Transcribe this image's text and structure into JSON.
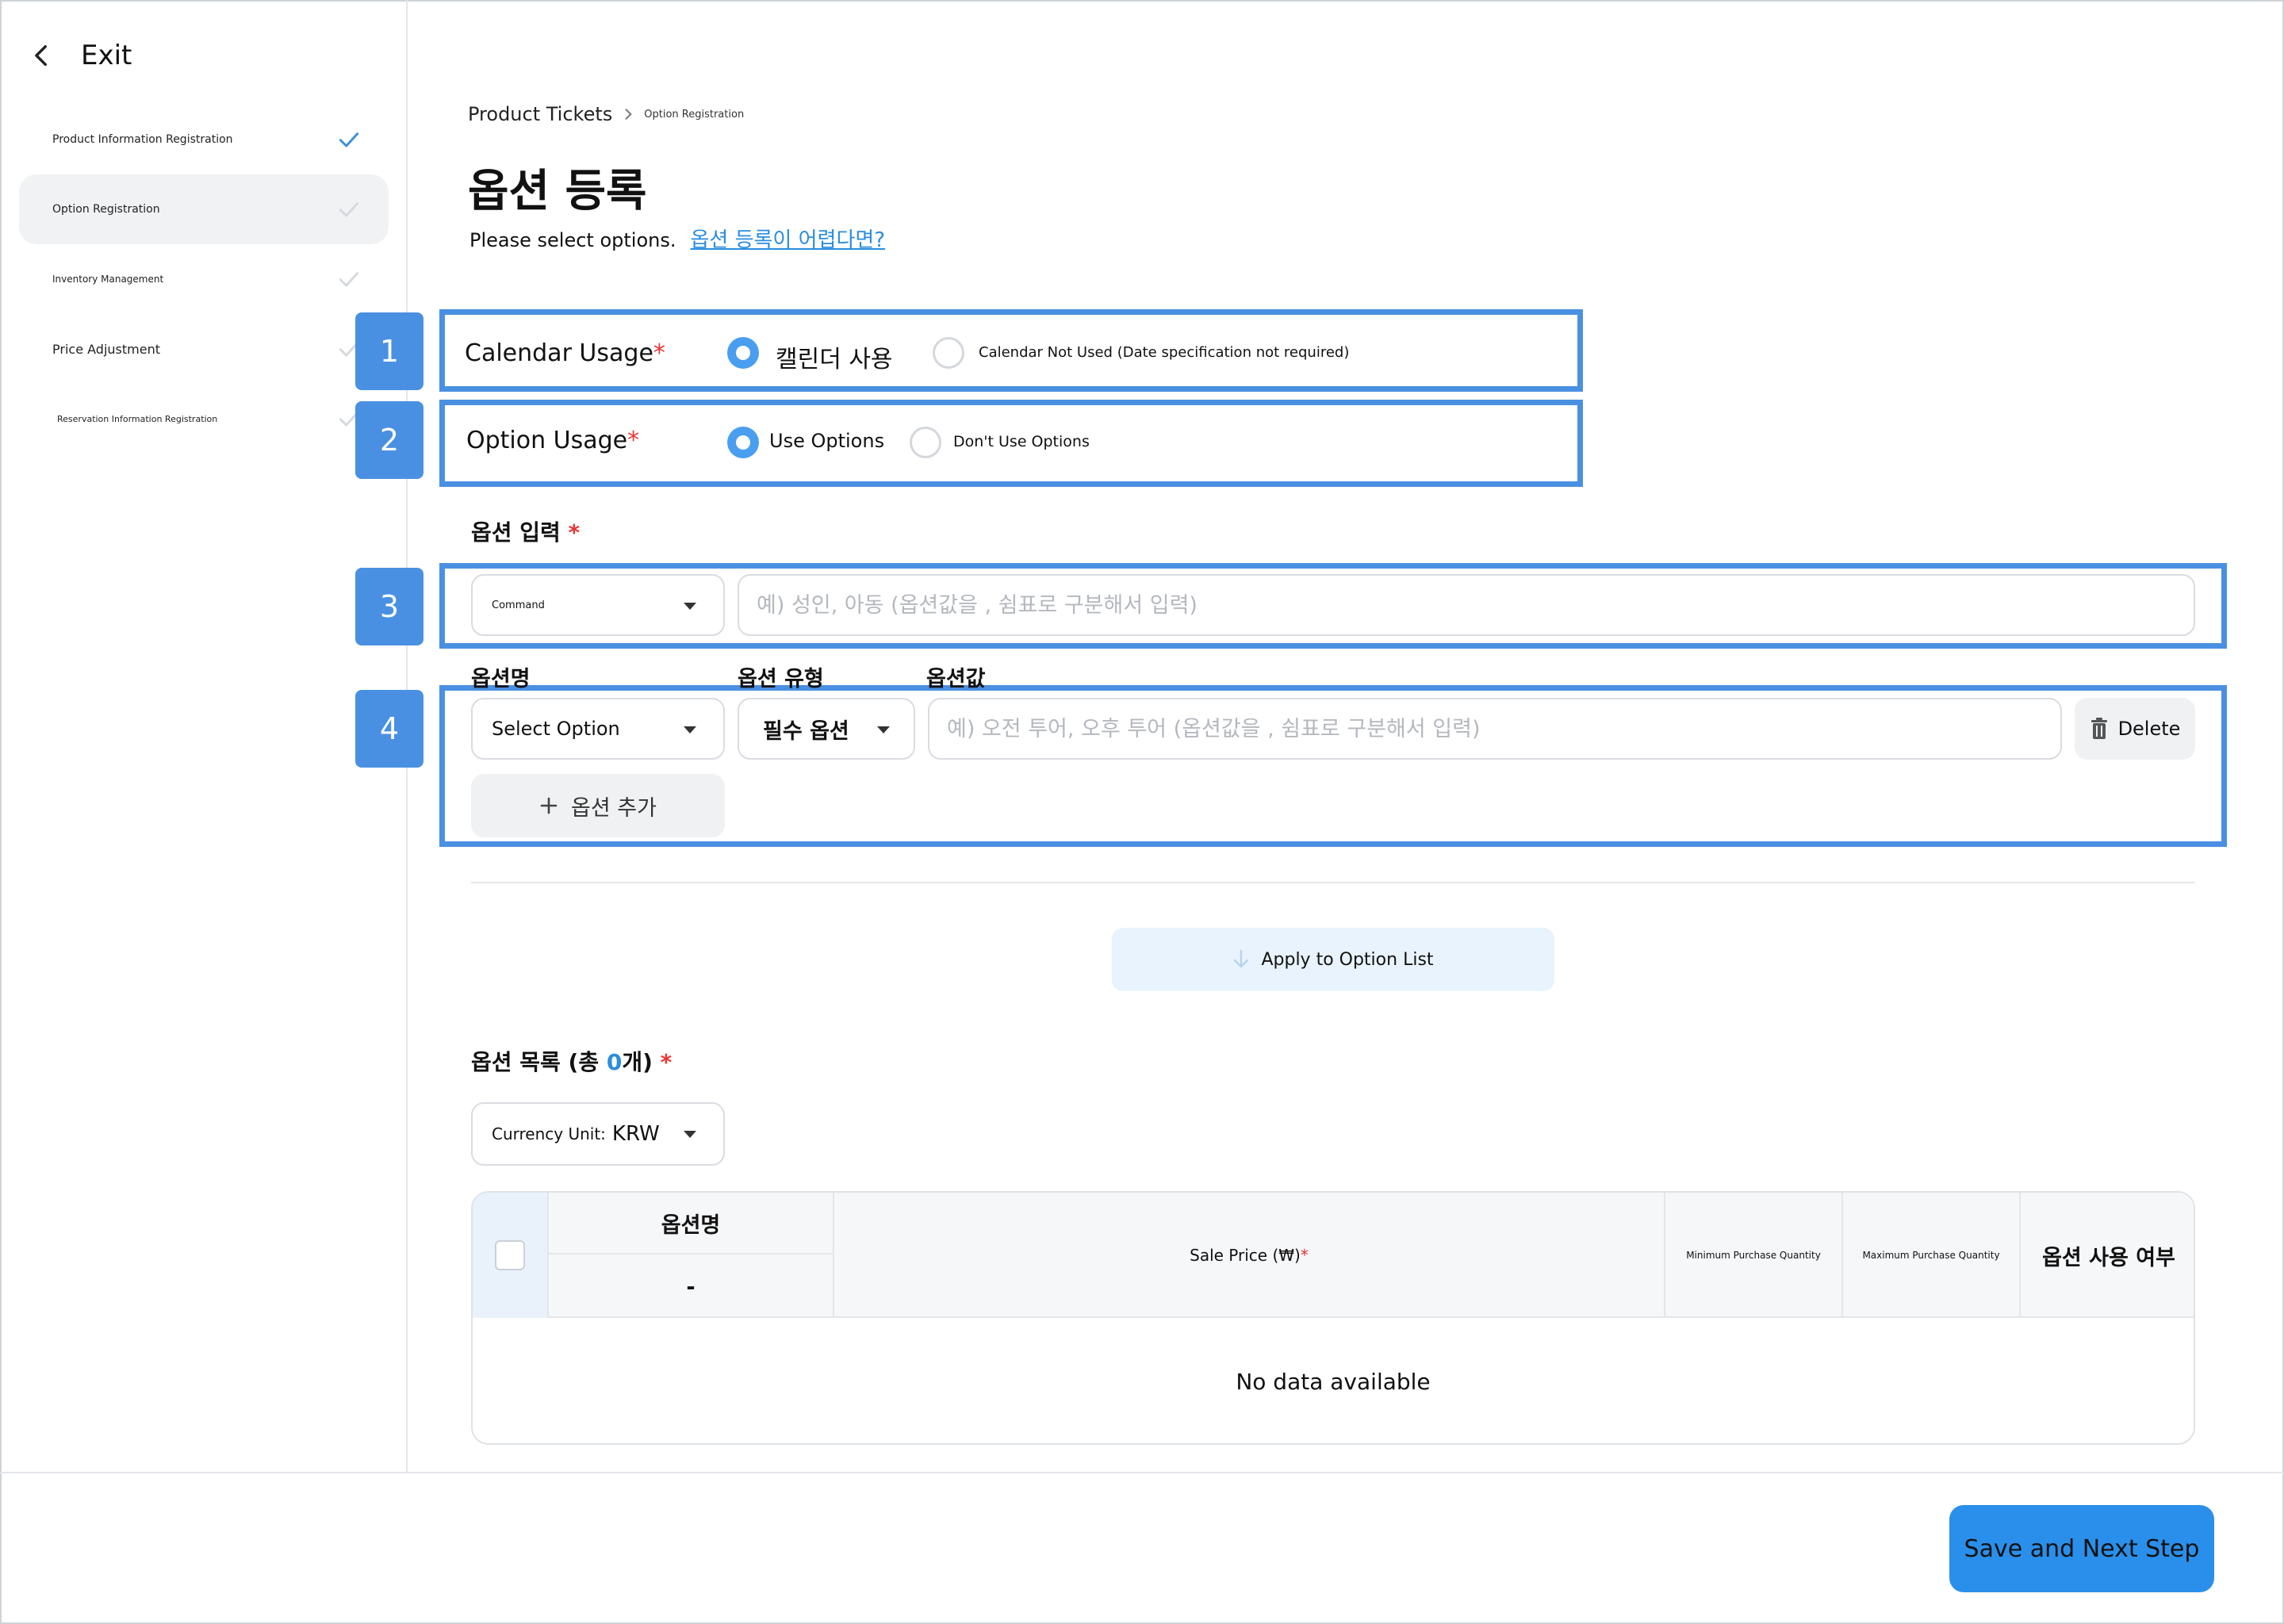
{
  "sidebar": {
    "exit_label": "Exit",
    "steps": [
      {
        "label": "Product Information Registration"
      },
      {
        "label": "Option Registration"
      },
      {
        "label": "Inventory Management"
      },
      {
        "label": "Price Adjustment"
      },
      {
        "label": "Reservation Information Registration"
      }
    ]
  },
  "breadcrumb": {
    "parent": "Product Tickets",
    "current": "Option Registration"
  },
  "page": {
    "title": "옵션 등록",
    "subtitle": "Please select options.",
    "help_link": "옵션 등록이 어렵다면?"
  },
  "badges": [
    "1",
    "2",
    "3",
    "4"
  ],
  "calendar": {
    "label": "Calendar Usage",
    "required": "*",
    "option_use": "캘린더 사용",
    "option_not_use": "Calendar Not Used (Date specification not required)"
  },
  "option_usage": {
    "label": "Option Usage",
    "required": "*",
    "option_use": "Use Options",
    "option_not_use": "Don't Use Options"
  },
  "option_input": {
    "title": "옵션 입력",
    "required": "*",
    "command_select": "Command",
    "command_placeholder": "예) 성인, 아동 (옵션값을 , 쉼표로 구분해서 입력)"
  },
  "option_row": {
    "col_name": "옵션명",
    "col_type": "옵션 유형",
    "col_value": "옵션값",
    "name_select": "Select Option",
    "type_select": "필수 옵션",
    "value_placeholder": "예) 오전 투어, 오후 투어 (옵션값을 , 쉼표로 구분해서 입력)",
    "delete_label": "Delete",
    "add_label": "옵션 추가"
  },
  "apply_button": "Apply to Option List",
  "option_list": {
    "title_prefix": "옵션 목록 (총 ",
    "count": "0",
    "title_suffix": "개)",
    "required": "*",
    "currency_label": "Currency Unit:",
    "currency_value": "KRW"
  },
  "table": {
    "headers": {
      "option_name": "옵션명",
      "option_name_sub": "-",
      "sale_price": "Sale Price (₩)",
      "sale_price_required": "*",
      "min_qty": "Minimum Purchase Quantity",
      "max_qty": "Maximum Purchase Quantity",
      "use_status": "옵션 사용 여부"
    },
    "empty_message": "No data available"
  },
  "footer": {
    "save_next": "Save and Next Step"
  },
  "colors": {
    "accent": "#4a90e2",
    "primary_button": "#2a8fea",
    "link": "#2a8de0",
    "required": "#e33333"
  }
}
